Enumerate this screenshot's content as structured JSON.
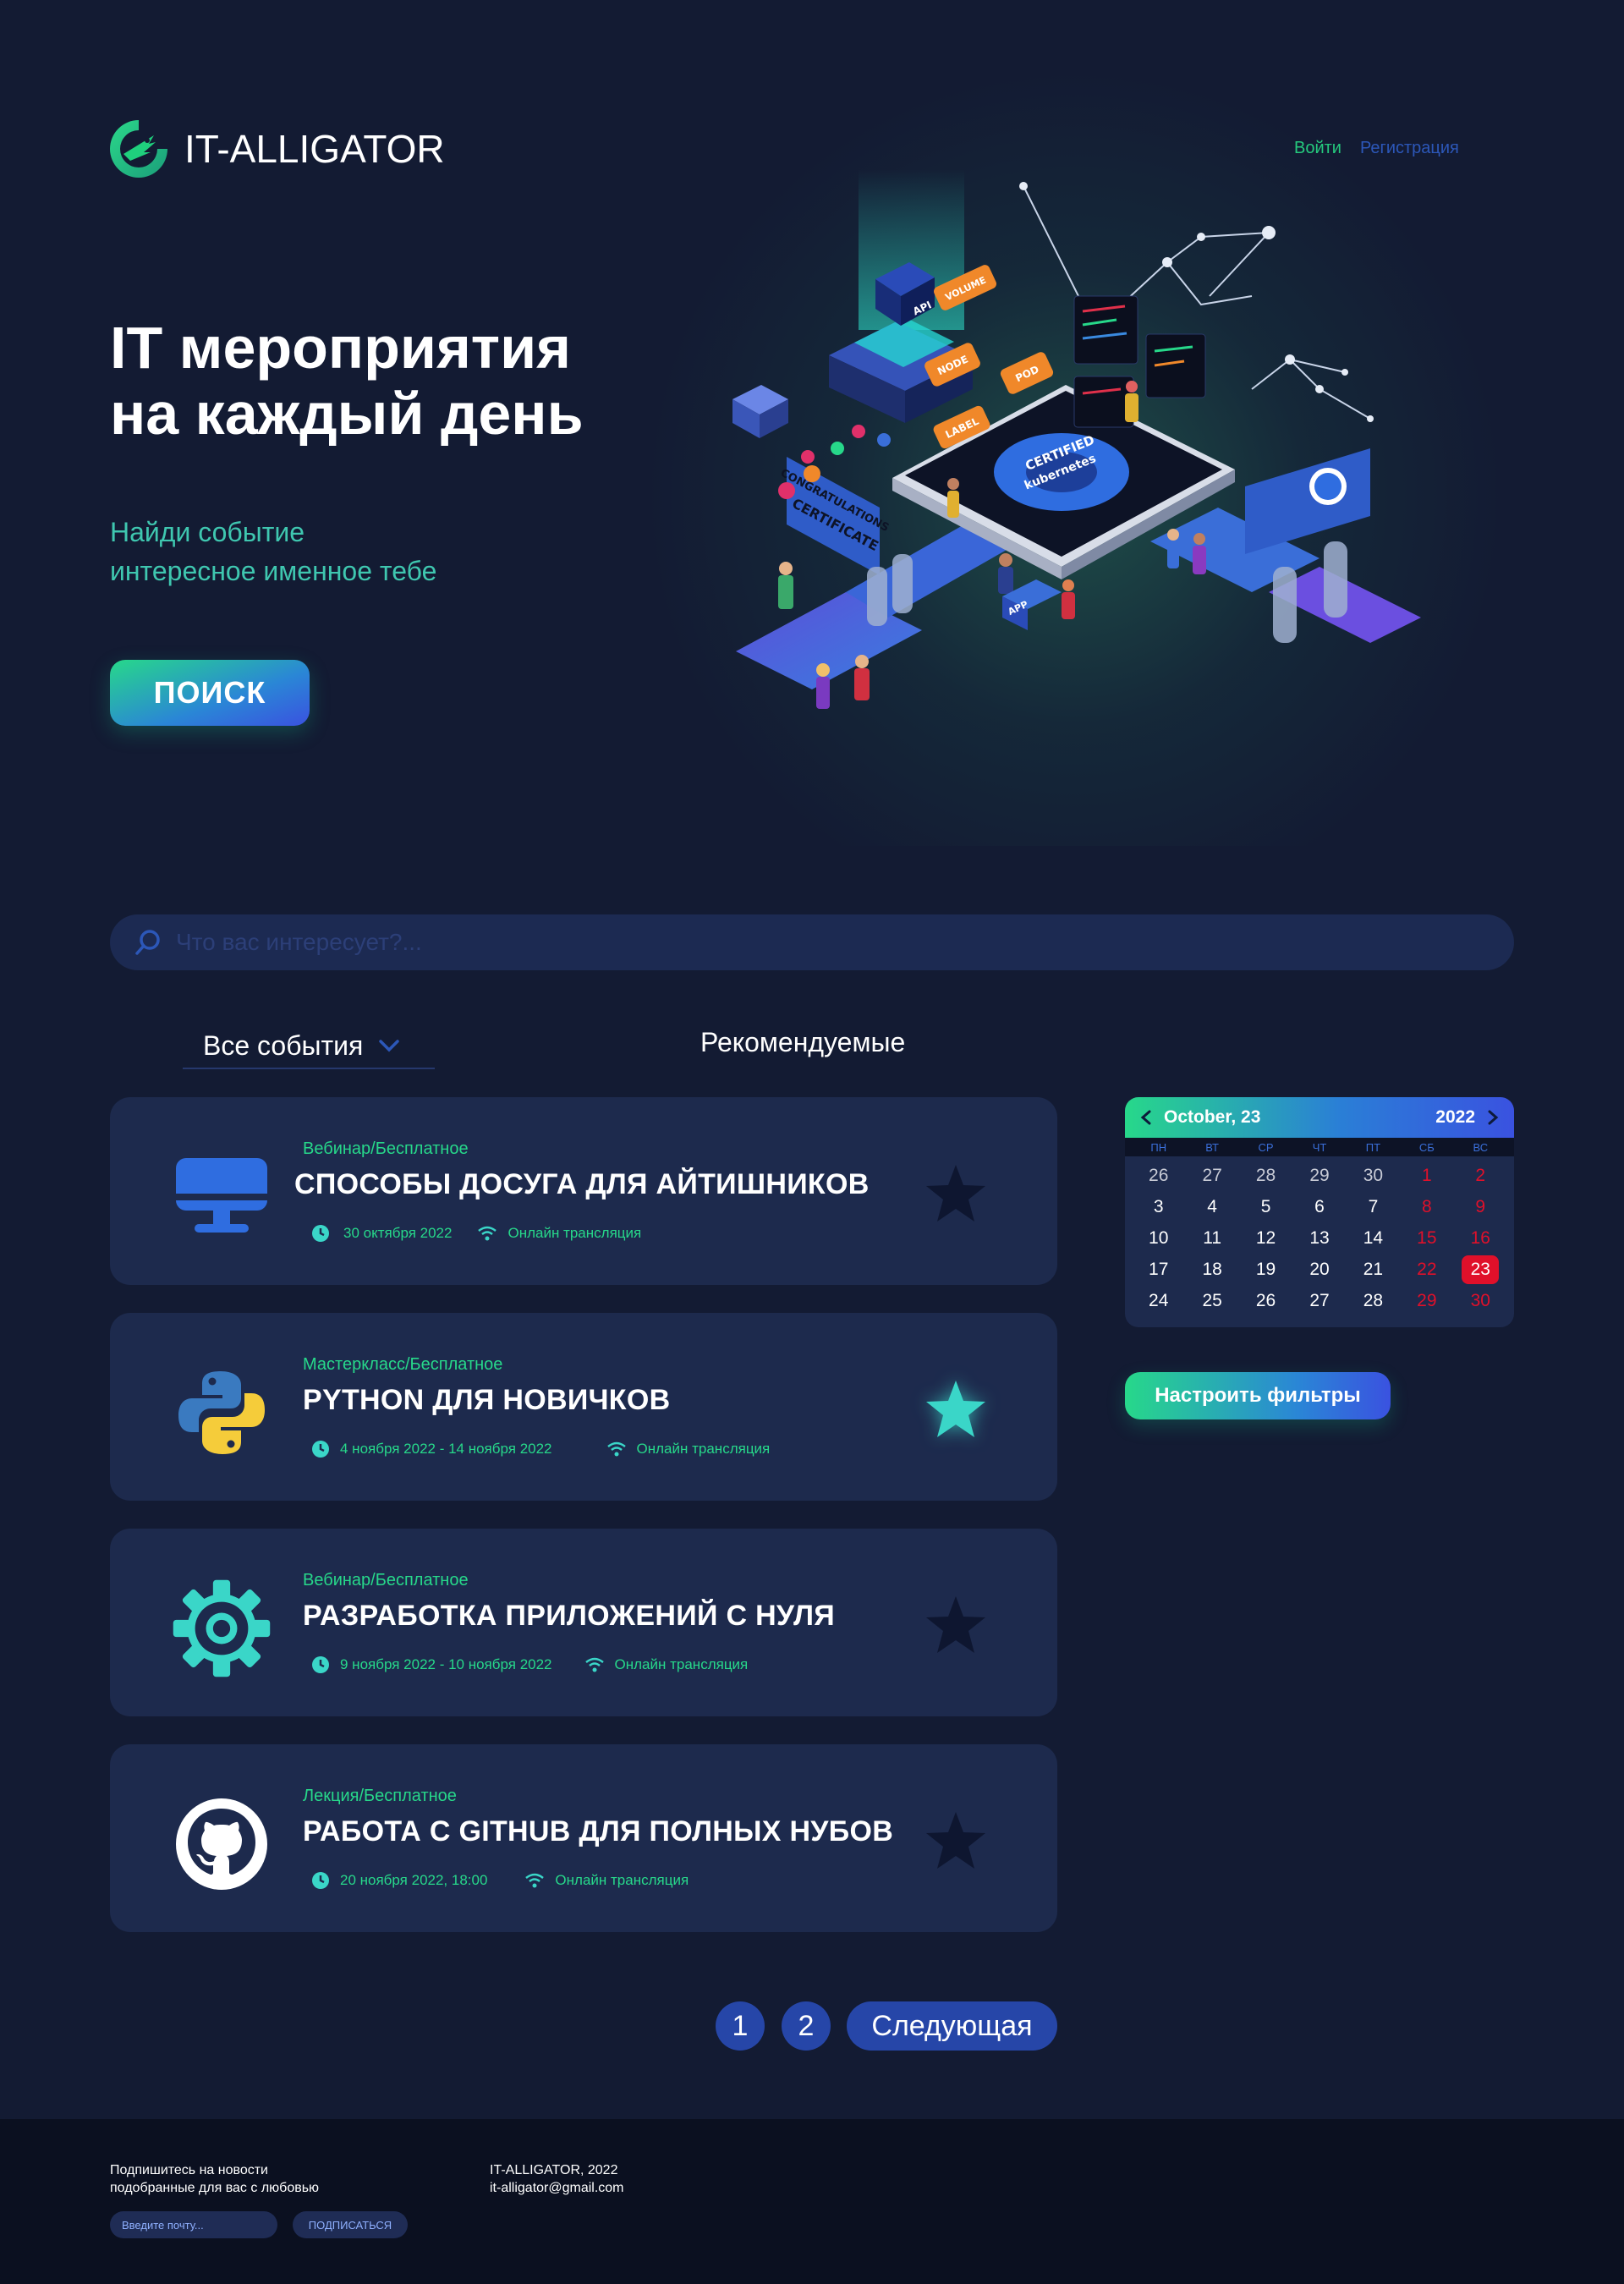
{
  "header": {
    "logo_text": "IT-ALLIGATOR",
    "login_label": "Войти",
    "register_label": "Регистрация"
  },
  "hero": {
    "title_line1": "IT мероприятия",
    "title_line2": "на каждый день",
    "subtitle_line1": "Найди событие",
    "subtitle_line2": "интересное именное тебе",
    "search_button": "ПОИСК"
  },
  "illustration_labels": {
    "node": "NODE",
    "pod": "POD",
    "label": "LABEL",
    "volume": "VOLUME",
    "api": "API",
    "app": "APP",
    "certified": "CERTIFIED",
    "kubernetes": "kubernetes",
    "congrats_line1": "CONGRATULATIONS",
    "congrats_line2": "CERTIFICATE"
  },
  "search": {
    "placeholder": "Что вас интересует?..."
  },
  "tabs": {
    "all_events": "Все события",
    "recommended": "Рекомендуемые"
  },
  "events": [
    {
      "category": "Вебинар/Бесплатное",
      "title": "СПОСОБЫ ДОСУГА ДЛЯ АЙТИШНИКОВ",
      "date": "30 октября 2022",
      "format": "Онлайн трансляция",
      "icon": "monitor-icon",
      "favorite": false
    },
    {
      "category": "Мастеркласс/Бесплатное",
      "title": "PYTHON ДЛЯ НОВИЧКОВ",
      "date": "4 ноября 2022 - 14 ноября 2022",
      "format": "Онлайн трансляция",
      "icon": "python-icon",
      "favorite": true
    },
    {
      "category": "Вебинар/Бесплатное",
      "title": "РАЗРАБОТКА ПРИЛОЖЕНИЙ С НУЛЯ",
      "date": "9 ноября 2022 - 10 ноября 2022",
      "format": "Онлайн трансляция",
      "icon": "gear-icon",
      "favorite": false
    },
    {
      "category": "Лекция/Бесплатное",
      "title": "РАБОТА С GITHUB ДЛЯ ПОЛНЫХ НУБОВ",
      "date": "20 ноября 2022, 18:00",
      "format": "Онлайн трансляция",
      "icon": "github-icon",
      "favorite": false
    }
  ],
  "calendar": {
    "month_label": "October, 23",
    "year_label": "2022",
    "weekdays": [
      "ПН",
      "ВТ",
      "СР",
      "ЧТ",
      "ПТ",
      "СБ",
      "ВС"
    ],
    "weeks": [
      [
        "26",
        "27",
        "28",
        "29",
        "30",
        "1",
        "2"
      ],
      [
        "3",
        "4",
        "5",
        "6",
        "7",
        "8",
        "9"
      ],
      [
        "10",
        "11",
        "12",
        "13",
        "14",
        "15",
        "16"
      ],
      [
        "17",
        "18",
        "19",
        "20",
        "21",
        "22",
        "23"
      ],
      [
        "24",
        "25",
        "26",
        "27",
        "28",
        "29",
        "30"
      ]
    ],
    "selected_day": "23"
  },
  "filters_button": "Настроить фильтры",
  "pagination": {
    "page1": "1",
    "page2": "2",
    "next": "Следующая"
  },
  "footer": {
    "newsletter_line1": "Подпишитесь на новости",
    "newsletter_line2": "подобранные для вас с любовью",
    "email_placeholder": "Введите почту...",
    "subscribe_label": "ПОДПИСАТЬСЯ",
    "copyright": "IT-ALLIGATOR, 2022",
    "email": "it-alligator@gmail.com"
  },
  "colors": {
    "background": "#131b33",
    "card": "#1d2a4d",
    "accent_green": "#27d88a",
    "accent_blue": "#2646a8",
    "weekend_red": "#e0102a",
    "favorite_star": "#3ad6c8",
    "inactive_star": "#0e1630"
  }
}
